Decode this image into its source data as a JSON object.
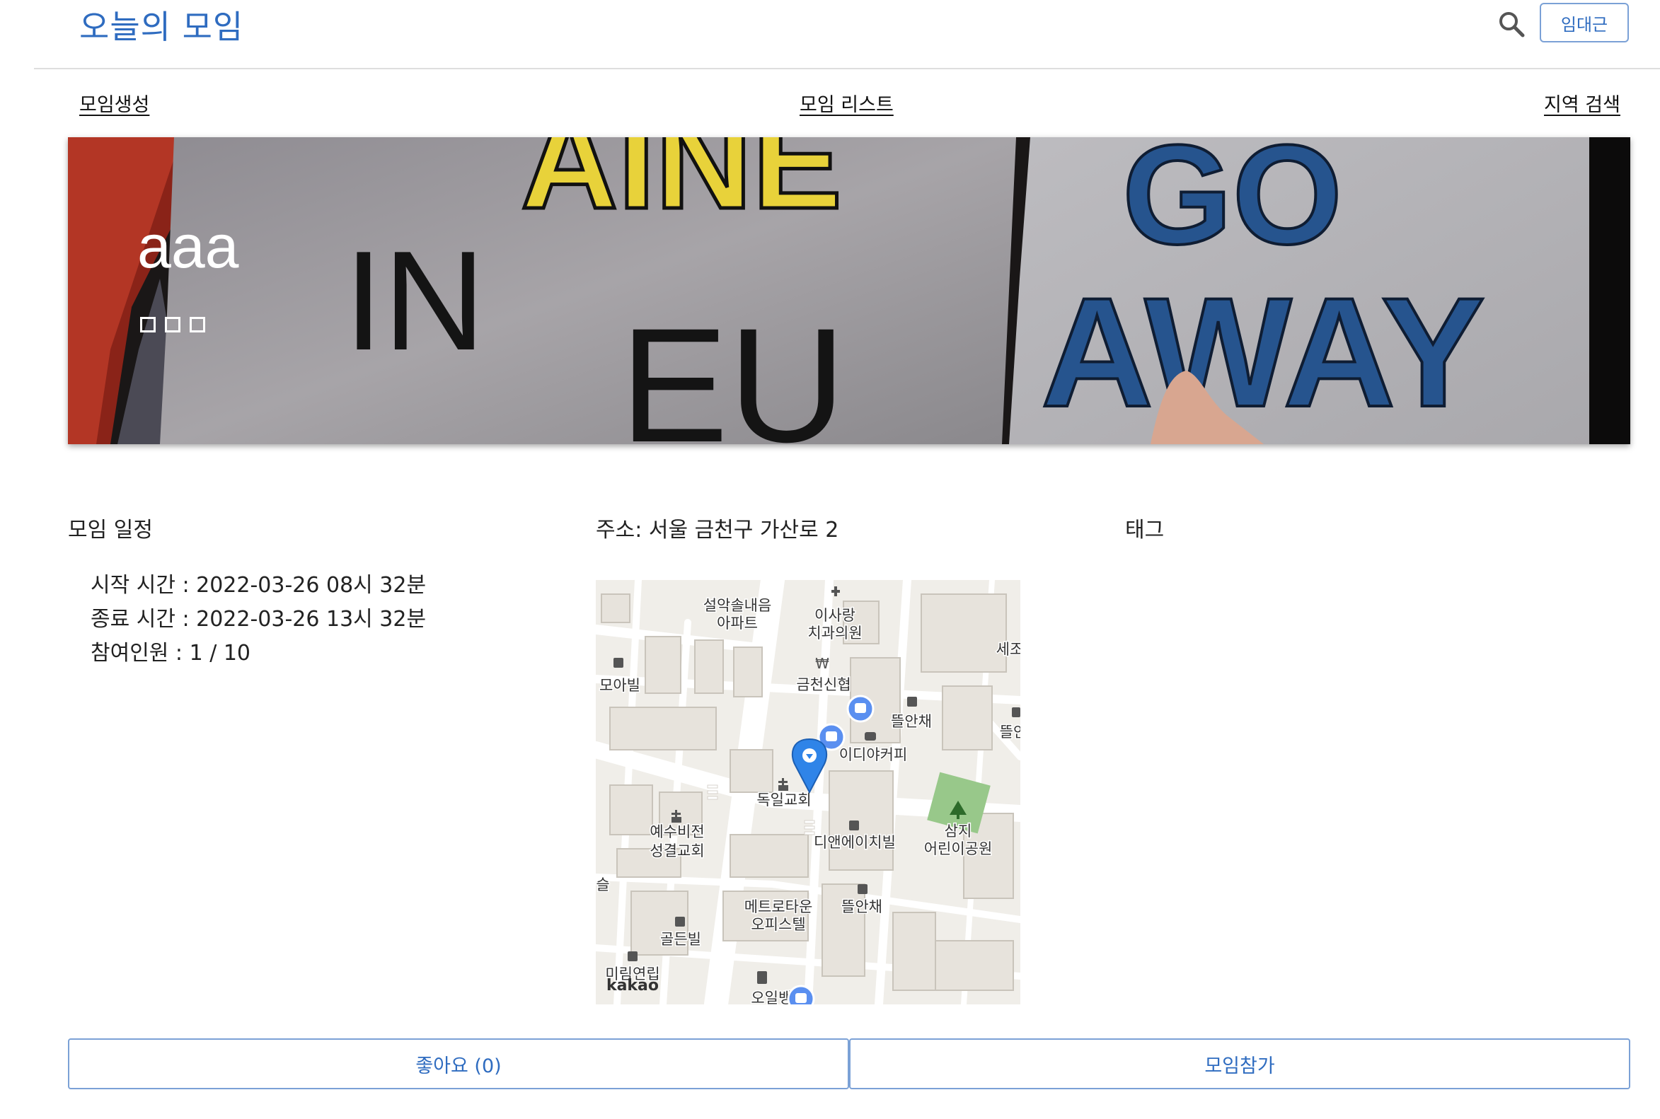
{
  "header": {
    "app_title": "오늘의 모임",
    "search_icon": "search-icon",
    "user_name": "임대근"
  },
  "nav": {
    "create": "모임생성",
    "list": "모임 리스트",
    "region_search": "지역 검색"
  },
  "banner": {
    "title": "aaa",
    "subtitle_placeholder": "□□□",
    "sign_text": [
      "AINE",
      "IN",
      "EU",
      "GO",
      "AWAY"
    ]
  },
  "details": {
    "schedule_label": "모임 일정",
    "start_time": "시작 시간 : 2022-03-26 08시 32분",
    "end_time": "종료 시간 : 2022-03-26 13시 32분",
    "participants": "참여인원 : 1 / 10",
    "address": "주소: 서울 금천구 가산로 2",
    "tags_label": "태그"
  },
  "map": {
    "labels": {
      "seolak": "설악솔내음",
      "apart": "아파트",
      "isarang": "이사랑",
      "dental": "치과의원",
      "moa": "모아빌",
      "credit": "금천신협",
      "sejo": "세조",
      "ttul1": "뜰안채",
      "ttul_edge": "뜰안",
      "ediya": "이디야커피",
      "church": "독일교회",
      "yesu": "예수비전",
      "holy": "성결교회",
      "dnh": "디앤에이치빌",
      "samji": "삼지",
      "park": "어린이공원",
      "metro": "메트로타운",
      "office": "오피스텔",
      "ttul2": "뜰안채",
      "golden": "골든빌",
      "mirim": "미림연립",
      "oil": "오일뱅크",
      "seul": "슬",
      "brand": "kakao"
    },
    "icons": [
      "marker-icon",
      "bus-stop-icon",
      "building-icon",
      "church-icon",
      "bank-icon",
      "cafe-icon",
      "tree-icon",
      "gas-station-icon",
      "hospital-icon"
    ]
  },
  "actions": {
    "like": "좋아요 (0)",
    "join": "모임참가"
  }
}
